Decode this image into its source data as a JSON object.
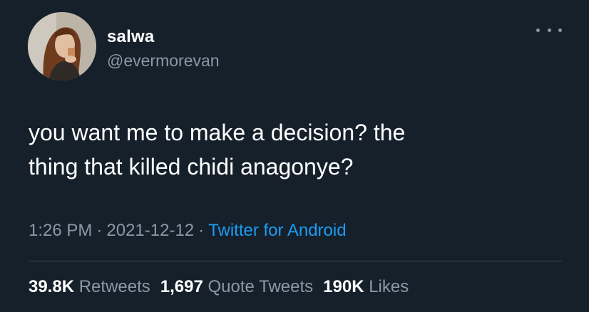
{
  "user": {
    "display_name": "salwa",
    "handle": "@evermorevan",
    "avatar_icon": "profile-photo"
  },
  "menu": {
    "more_icon": "more-horizontal-icon"
  },
  "tweet": {
    "text": "you want me to make a decision? the\nthing that killed chidi anagonye?",
    "time": "1:26 PM",
    "date": "2021-12-12",
    "separator": "·",
    "source": "Twitter for Android"
  },
  "stats": {
    "retweets_count": "39.8K",
    "retweets_label": "Retweets",
    "quotes_count": "1,697",
    "quotes_label": "Quote Tweets",
    "likes_count": "190K",
    "likes_label": "Likes"
  },
  "colors": {
    "background": "#15202b",
    "secondary_text": "#8b98a5",
    "link": "#1d9bf0",
    "divider": "#38444d"
  }
}
